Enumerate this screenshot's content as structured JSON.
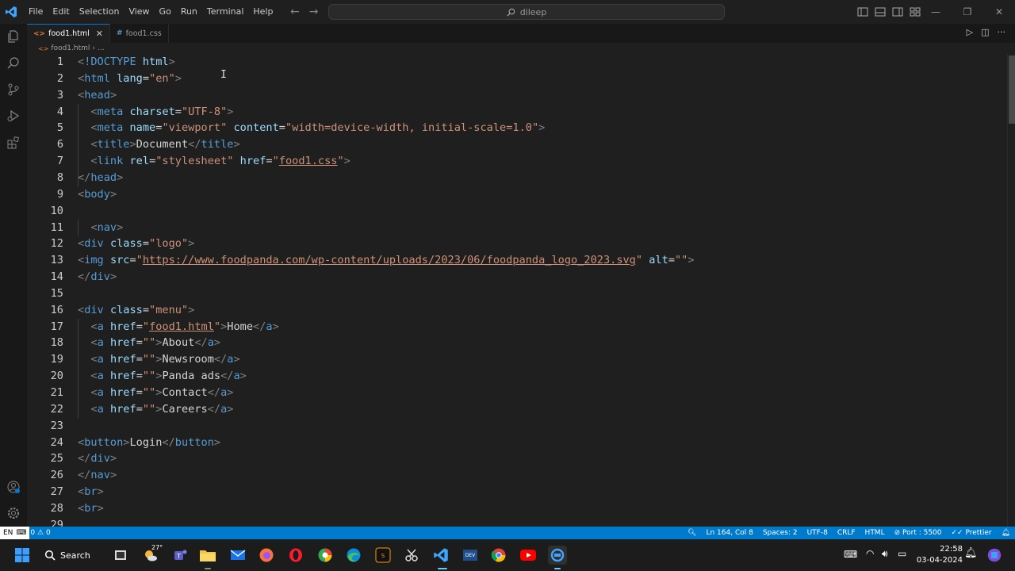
{
  "titlebar": {
    "menus": [
      "File",
      "Edit",
      "Selection",
      "View",
      "Go",
      "Run",
      "Terminal",
      "Help"
    ],
    "search_text": "dileep"
  },
  "tabs": [
    {
      "label": "food1.html",
      "icon": "<>",
      "active": true
    },
    {
      "label": "food1.css",
      "icon": "#",
      "active": false
    }
  ],
  "breadcrumb": {
    "file": "food1.html",
    "rest": "..."
  },
  "editor": {
    "lines": [
      {
        "n": "1",
        "tokens": [
          [
            "br",
            "<"
          ],
          [
            "dt",
            "!DOCTYPE"
          ],
          [
            "txt",
            " "
          ],
          [
            "attr",
            "html"
          ],
          [
            "br",
            ">"
          ]
        ]
      },
      {
        "n": "2",
        "tokens": [
          [
            "br",
            "<"
          ],
          [
            "tag",
            "html"
          ],
          [
            "txt",
            " "
          ],
          [
            "attr",
            "lang"
          ],
          [
            "txt",
            "="
          ],
          [
            "str",
            "\"en\""
          ],
          [
            "br",
            ">"
          ]
        ]
      },
      {
        "n": "3",
        "tokens": [
          [
            "br",
            "<"
          ],
          [
            "tag",
            "head"
          ],
          [
            "br",
            ">"
          ]
        ]
      },
      {
        "n": "4",
        "tokens": [
          [
            "txt",
            "  "
          ],
          [
            "br",
            "<"
          ],
          [
            "tag",
            "meta"
          ],
          [
            "txt",
            " "
          ],
          [
            "attr",
            "charset"
          ],
          [
            "txt",
            "="
          ],
          [
            "str",
            "\"UTF-8\""
          ],
          [
            "br",
            ">"
          ]
        ]
      },
      {
        "n": "5",
        "tokens": [
          [
            "txt",
            "  "
          ],
          [
            "br",
            "<"
          ],
          [
            "tag",
            "meta"
          ],
          [
            "txt",
            " "
          ],
          [
            "attr",
            "name"
          ],
          [
            "txt",
            "="
          ],
          [
            "str",
            "\"viewport\""
          ],
          [
            "txt",
            " "
          ],
          [
            "attr",
            "content"
          ],
          [
            "txt",
            "="
          ],
          [
            "str",
            "\"width=device-width, initial-scale=1.0\""
          ],
          [
            "br",
            ">"
          ]
        ]
      },
      {
        "n": "6",
        "tokens": [
          [
            "txt",
            "  "
          ],
          [
            "br",
            "<"
          ],
          [
            "tag",
            "title"
          ],
          [
            "br",
            ">"
          ],
          [
            "txt",
            "Document"
          ],
          [
            "br",
            "</"
          ],
          [
            "tag",
            "title"
          ],
          [
            "br",
            ">"
          ]
        ]
      },
      {
        "n": "7",
        "tokens": [
          [
            "txt",
            "  "
          ],
          [
            "br",
            "<"
          ],
          [
            "tag",
            "link"
          ],
          [
            "txt",
            " "
          ],
          [
            "attr",
            "rel"
          ],
          [
            "txt",
            "="
          ],
          [
            "str",
            "\"stylesheet\""
          ],
          [
            "txt",
            " "
          ],
          [
            "attr",
            "href"
          ],
          [
            "txt",
            "="
          ],
          [
            "str",
            "\""
          ],
          [
            "link",
            "food1.css"
          ],
          [
            "str",
            "\""
          ],
          [
            "br",
            ">"
          ]
        ]
      },
      {
        "n": "8",
        "tokens": [
          [
            "br",
            "</"
          ],
          [
            "tag",
            "head"
          ],
          [
            "br",
            ">"
          ]
        ]
      },
      {
        "n": "9",
        "tokens": [
          [
            "br",
            "<"
          ],
          [
            "tag",
            "body"
          ],
          [
            "br",
            ">"
          ]
        ]
      },
      {
        "n": "10",
        "tokens": []
      },
      {
        "n": "11",
        "tokens": [
          [
            "txt",
            "  "
          ],
          [
            "br",
            "<"
          ],
          [
            "tag",
            "nav"
          ],
          [
            "br",
            ">"
          ]
        ]
      },
      {
        "n": "12",
        "tokens": [
          [
            "br",
            "<"
          ],
          [
            "tag",
            "div"
          ],
          [
            "txt",
            " "
          ],
          [
            "attr",
            "class"
          ],
          [
            "txt",
            "="
          ],
          [
            "str",
            "\"logo\""
          ],
          [
            "br",
            ">"
          ]
        ]
      },
      {
        "n": "13",
        "tokens": [
          [
            "br",
            "<"
          ],
          [
            "tag",
            "img"
          ],
          [
            "txt",
            " "
          ],
          [
            "attr",
            "src"
          ],
          [
            "txt",
            "="
          ],
          [
            "str",
            "\""
          ],
          [
            "link",
            "https://www.foodpanda.com/wp-content/uploads/2023/06/foodpanda_logo_2023.svg"
          ],
          [
            "str",
            "\""
          ],
          [
            "txt",
            " "
          ],
          [
            "attr",
            "alt"
          ],
          [
            "txt",
            "="
          ],
          [
            "str",
            "\"\""
          ],
          [
            "br",
            ">"
          ]
        ]
      },
      {
        "n": "14",
        "tokens": [
          [
            "br",
            "</"
          ],
          [
            "tag",
            "div"
          ],
          [
            "br",
            ">"
          ]
        ]
      },
      {
        "n": "15",
        "tokens": []
      },
      {
        "n": "16",
        "tokens": [
          [
            "br",
            "<"
          ],
          [
            "tag",
            "div"
          ],
          [
            "txt",
            " "
          ],
          [
            "attr",
            "class"
          ],
          [
            "txt",
            "="
          ],
          [
            "str",
            "\"menu\""
          ],
          [
            "br",
            ">"
          ]
        ]
      },
      {
        "n": "17",
        "tokens": [
          [
            "txt",
            "  "
          ],
          [
            "br",
            "<"
          ],
          [
            "tag",
            "a"
          ],
          [
            "txt",
            " "
          ],
          [
            "attr",
            "href"
          ],
          [
            "txt",
            "="
          ],
          [
            "str",
            "\""
          ],
          [
            "link",
            "food1.html"
          ],
          [
            "str",
            "\""
          ],
          [
            "br",
            ">"
          ],
          [
            "txt",
            "Home"
          ],
          [
            "br",
            "</"
          ],
          [
            "tag",
            "a"
          ],
          [
            "br",
            ">"
          ]
        ]
      },
      {
        "n": "18",
        "tokens": [
          [
            "txt",
            "  "
          ],
          [
            "br",
            "<"
          ],
          [
            "tag",
            "a"
          ],
          [
            "txt",
            " "
          ],
          [
            "attr",
            "href"
          ],
          [
            "txt",
            "="
          ],
          [
            "str",
            "\"\""
          ],
          [
            "br",
            ">"
          ],
          [
            "txt",
            "About"
          ],
          [
            "br",
            "</"
          ],
          [
            "tag",
            "a"
          ],
          [
            "br",
            ">"
          ]
        ]
      },
      {
        "n": "19",
        "tokens": [
          [
            "txt",
            "  "
          ],
          [
            "br",
            "<"
          ],
          [
            "tag",
            "a"
          ],
          [
            "txt",
            " "
          ],
          [
            "attr",
            "href"
          ],
          [
            "txt",
            "="
          ],
          [
            "str",
            "\"\""
          ],
          [
            "br",
            ">"
          ],
          [
            "txt",
            "Newsroom"
          ],
          [
            "br",
            "</"
          ],
          [
            "tag",
            "a"
          ],
          [
            "br",
            ">"
          ]
        ]
      },
      {
        "n": "20",
        "tokens": [
          [
            "txt",
            "  "
          ],
          [
            "br",
            "<"
          ],
          [
            "tag",
            "a"
          ],
          [
            "txt",
            " "
          ],
          [
            "attr",
            "href"
          ],
          [
            "txt",
            "="
          ],
          [
            "str",
            "\"\""
          ],
          [
            "br",
            ">"
          ],
          [
            "txt",
            "Panda ads"
          ],
          [
            "br",
            "</"
          ],
          [
            "tag",
            "a"
          ],
          [
            "br",
            ">"
          ]
        ]
      },
      {
        "n": "21",
        "tokens": [
          [
            "txt",
            "  "
          ],
          [
            "br",
            "<"
          ],
          [
            "tag",
            "a"
          ],
          [
            "txt",
            " "
          ],
          [
            "attr",
            "href"
          ],
          [
            "txt",
            "="
          ],
          [
            "str",
            "\"\""
          ],
          [
            "br",
            ">"
          ],
          [
            "txt",
            "Contact"
          ],
          [
            "br",
            "</"
          ],
          [
            "tag",
            "a"
          ],
          [
            "br",
            ">"
          ]
        ]
      },
      {
        "n": "22",
        "tokens": [
          [
            "txt",
            "  "
          ],
          [
            "br",
            "<"
          ],
          [
            "tag",
            "a"
          ],
          [
            "txt",
            " "
          ],
          [
            "attr",
            "href"
          ],
          [
            "txt",
            "="
          ],
          [
            "str",
            "\"\""
          ],
          [
            "br",
            ">"
          ],
          [
            "txt",
            "Careers"
          ],
          [
            "br",
            "</"
          ],
          [
            "tag",
            "a"
          ],
          [
            "br",
            ">"
          ]
        ]
      },
      {
        "n": "23",
        "tokens": []
      },
      {
        "n": "24",
        "tokens": [
          [
            "br",
            "<"
          ],
          [
            "tag",
            "button"
          ],
          [
            "br",
            ">"
          ],
          [
            "txt",
            "Login"
          ],
          [
            "br",
            "</"
          ],
          [
            "tag",
            "button"
          ],
          [
            "br",
            ">"
          ]
        ]
      },
      {
        "n": "25",
        "tokens": [
          [
            "br",
            "</"
          ],
          [
            "tag",
            "div"
          ],
          [
            "br",
            ">"
          ]
        ]
      },
      {
        "n": "26",
        "tokens": [
          [
            "br",
            "</"
          ],
          [
            "tag",
            "nav"
          ],
          [
            "br",
            ">"
          ]
        ]
      },
      {
        "n": "27",
        "tokens": [
          [
            "br",
            "<"
          ],
          [
            "tag",
            "br"
          ],
          [
            "br",
            ">"
          ]
        ]
      },
      {
        "n": "28",
        "tokens": [
          [
            "br",
            "<"
          ],
          [
            "tag",
            "br"
          ],
          [
            "br",
            ">"
          ]
        ]
      },
      {
        "n": "29",
        "tokens": []
      }
    ]
  },
  "statusbar": {
    "problems": "0",
    "warnings": "0",
    "position": "Ln 164, Col 8",
    "spaces": "Spaces: 2",
    "encoding": "UTF-8",
    "eol": "CRLF",
    "language": "HTML",
    "port": "Port : 5500",
    "prettier": "Prettier"
  },
  "taskbar": {
    "search_label": "Search",
    "weather": "27°",
    "time": "22:58",
    "date": "03-04-2024",
    "lang": "EN"
  },
  "colors": {
    "accent": "#007acc",
    "tag": "#569cd6",
    "attr": "#9cdcfe",
    "string": "#ce9178"
  }
}
